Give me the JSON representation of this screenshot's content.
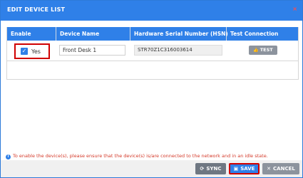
{
  "dialog": {
    "title": "EDIT DEVICE LIST",
    "close_icon": "×"
  },
  "table": {
    "headers": [
      "Enable",
      "Device Name",
      "Hardware Serial Number (HSN)",
      "Test Connection"
    ],
    "rows": [
      {
        "enabled_checked": true,
        "enable_label": "Yes",
        "device_name": "Front Desk 1",
        "hsn": "STR70Z1C316003614",
        "test_label": "TEST"
      }
    ]
  },
  "info": {
    "message": "To enable the device(s), please ensure that the device(s) is/are connected to the network and in an idle state."
  },
  "footer": {
    "sync_label": "SYNC",
    "save_label": "SAVE",
    "cancel_label": "CANCEL"
  },
  "colors": {
    "primary": "#2f80e8",
    "highlight": "#d00000",
    "info_text": "#d43a2a",
    "button_gray": "#8c939d"
  }
}
